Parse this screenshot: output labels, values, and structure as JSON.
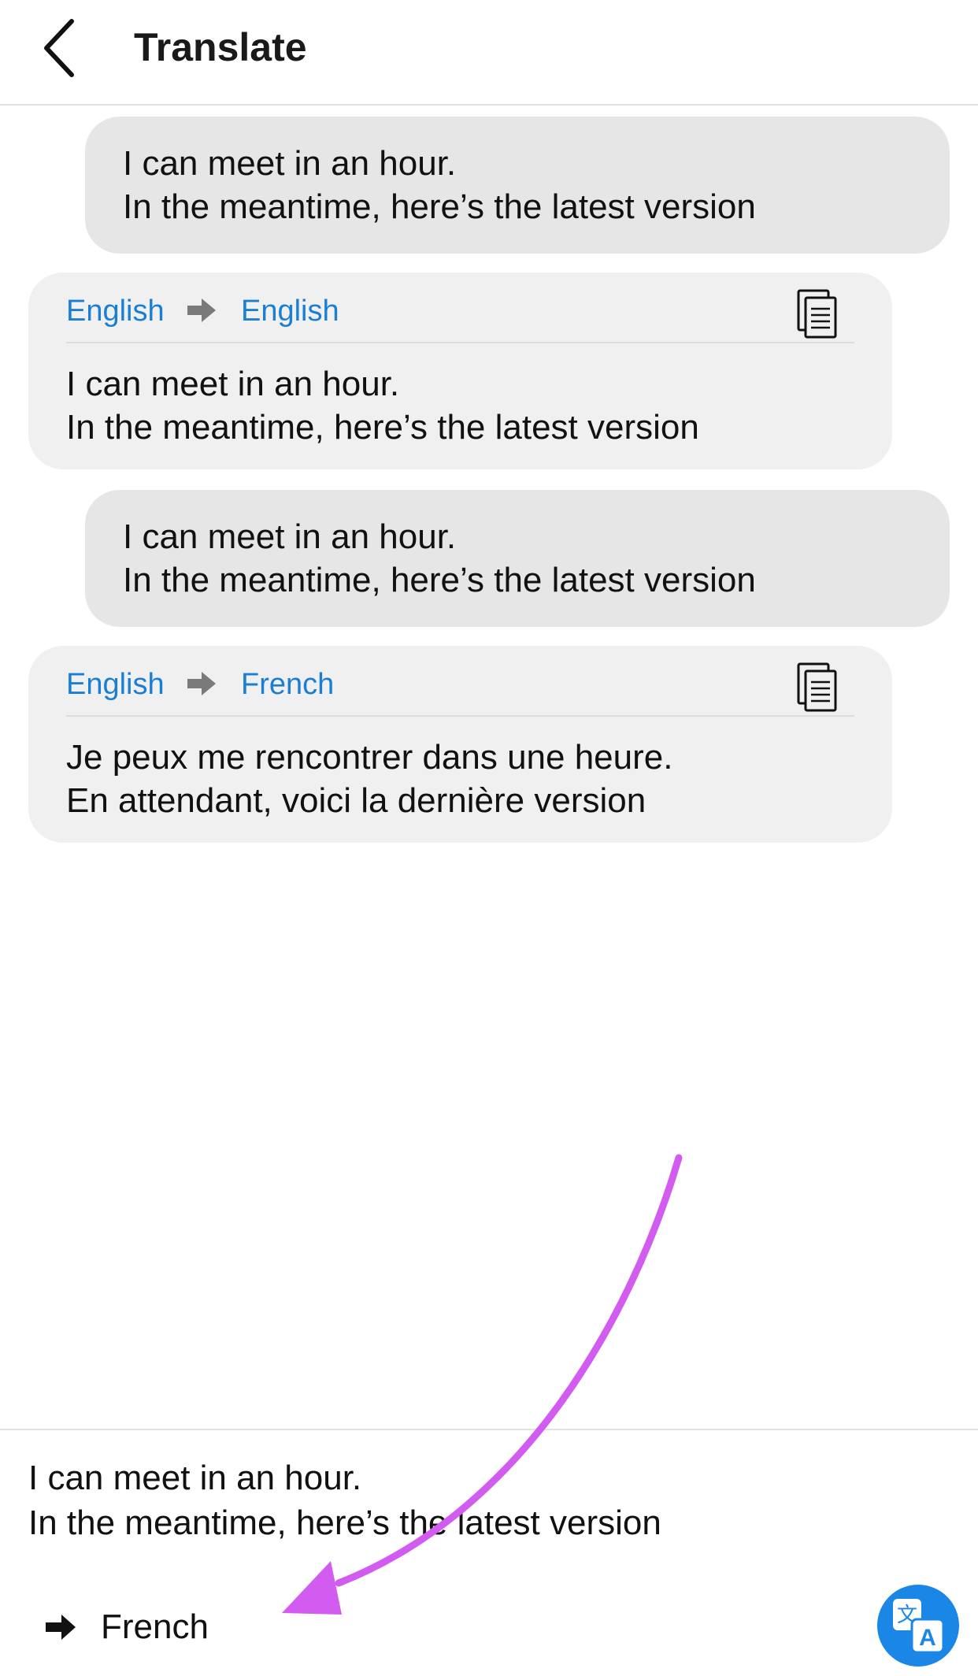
{
  "header": {
    "title": "Translate",
    "back_icon": "chevron-left-icon"
  },
  "messages": [
    {
      "source_lines": [
        "I can meet in an hour.",
        "In the meantime, here’s the latest version"
      ],
      "translation": {
        "from": "English",
        "to": "English",
        "lines": [
          "I can meet in an hour.",
          "In the meantime, here’s the latest version"
        ]
      }
    },
    {
      "source_lines": [
        "I can meet in an hour.",
        "In the meantime, here’s the latest version"
      ],
      "translation": {
        "from": "English",
        "to": "French",
        "lines": [
          "Je peux me rencontrer dans une heure.",
          "En attendant, voici la dernière version"
        ]
      }
    }
  ],
  "composer": {
    "input_lines": [
      "I can meet in an hour.",
      "In the meantime, here’s the latest version"
    ],
    "target_language": "French",
    "translate_icon": "translate-icon"
  },
  "colors": {
    "accent": "#1a87e6",
    "lang_label": "#1a7fd4",
    "source_bubble": "#e6e6e6",
    "translation_card": "#f0f0f0",
    "annotation_arrow": "#d35cf0"
  }
}
